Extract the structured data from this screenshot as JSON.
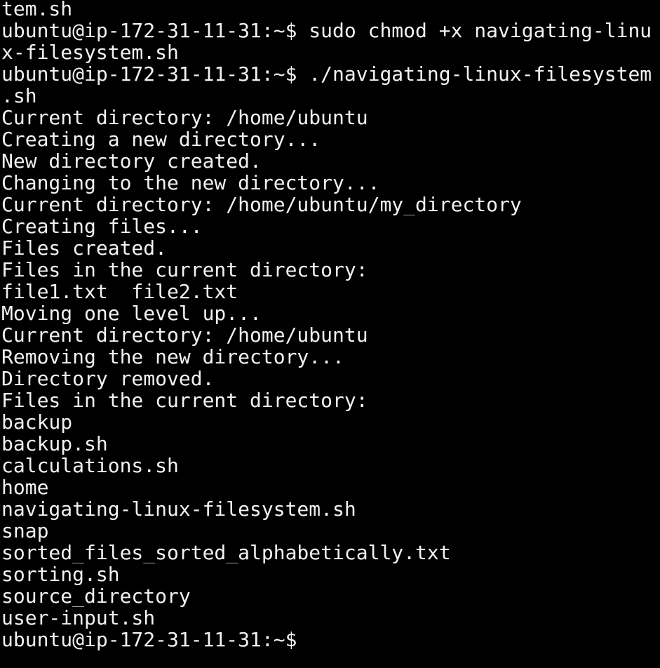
{
  "terminal": {
    "lines": [
      "tem.sh",
      "ubuntu@ip-172-31-11-31:~$ sudo chmod +x navigating-linu",
      "x-filesystem.sh",
      "ubuntu@ip-172-31-11-31:~$ ./navigating-linux-filesystem",
      ".sh",
      "Current directory: /home/ubuntu",
      "Creating a new directory...",
      "New directory created.",
      "Changing to the new directory...",
      "Current directory: /home/ubuntu/my_directory",
      "Creating files...",
      "Files created.",
      "Files in the current directory:",
      "file1.txt  file2.txt",
      "Moving one level up...",
      "Current directory: /home/ubuntu",
      "Removing the new directory...",
      "Directory removed.",
      "Files in the current directory:",
      "backup",
      "backup.sh",
      "calculations.sh",
      "home",
      "navigating-linux-filesystem.sh",
      "snap",
      "sorted_files_sorted_alphabetically.txt",
      "sorting.sh",
      "source_directory",
      "user-input.sh"
    ],
    "prompt": "ubuntu@ip-172-31-11-31:~$ "
  },
  "colors": {
    "background": "#000000",
    "foreground": "#f2f2f2"
  }
}
